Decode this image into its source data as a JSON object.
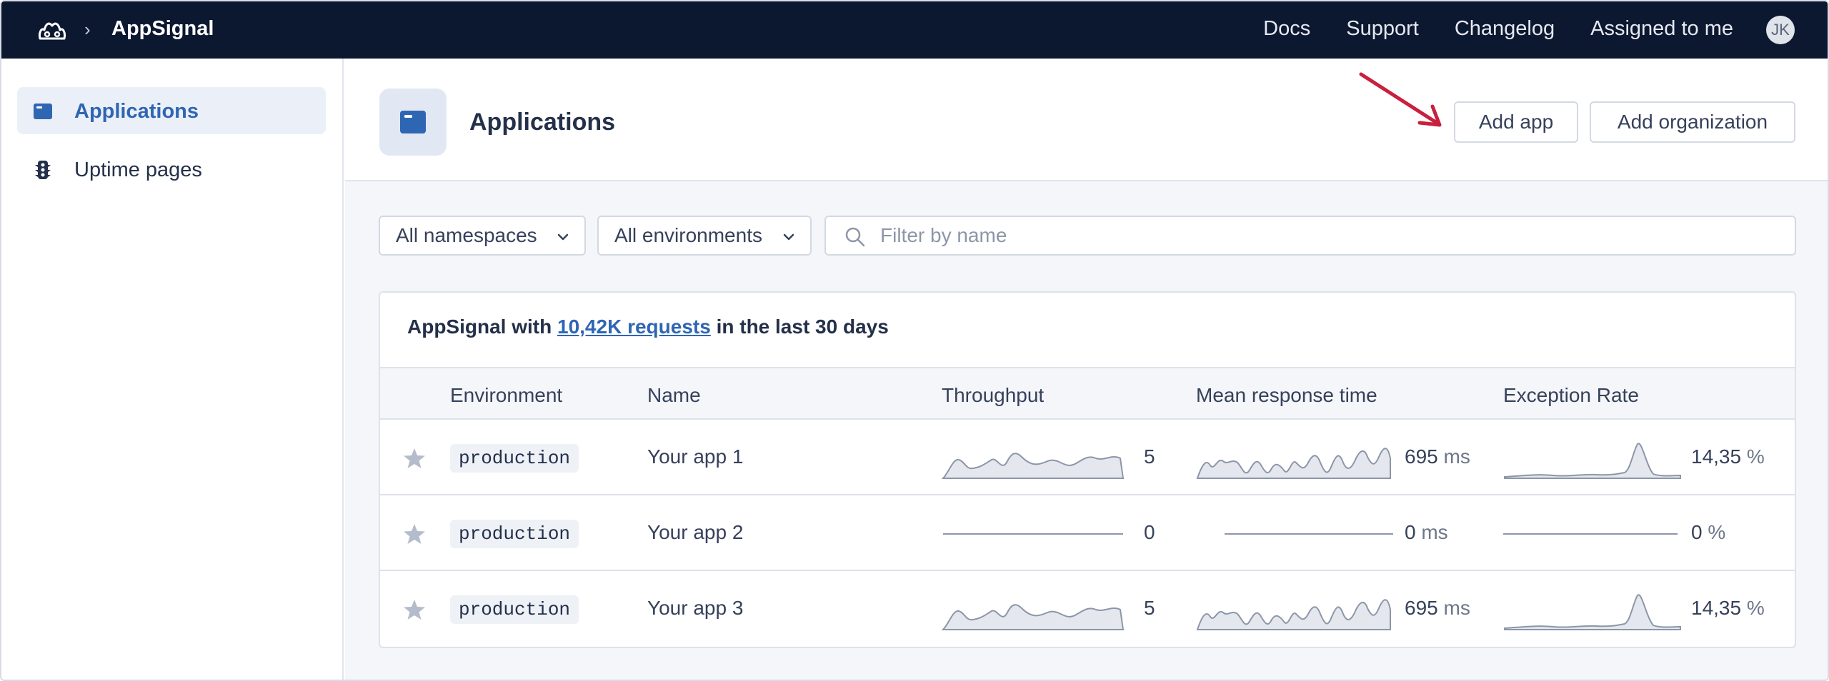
{
  "topbar": {
    "brand": "AppSignal",
    "separator": "›",
    "nav": [
      "Docs",
      "Support",
      "Changelog",
      "Assigned to me"
    ],
    "avatar_initials": "JK"
  },
  "sidebar": {
    "items": [
      {
        "label": "Applications",
        "icon": "app-window-icon",
        "active": true
      },
      {
        "label": "Uptime pages",
        "icon": "traffic-light-icon",
        "active": false
      }
    ]
  },
  "header": {
    "title": "Applications",
    "add_app_label": "Add app",
    "add_org_label": "Add organization"
  },
  "filters": {
    "namespaces": "All namespaces",
    "environments": "All environments",
    "search_placeholder": "Filter by name"
  },
  "card": {
    "title_prefix": "AppSignal with ",
    "title_link": "10,42K requests",
    "title_suffix": " in the last 30 days"
  },
  "table": {
    "columns": [
      "Environment",
      "Name",
      "Throughput",
      "Mean response time",
      "Exception Rate"
    ],
    "rows": [
      {
        "env": "production",
        "name": "Your app 1",
        "throughput": "5",
        "response": "695",
        "response_unit": "ms",
        "exceptions": "14,35",
        "exceptions_unit": "%",
        "flat": false
      },
      {
        "env": "production",
        "name": "Your app 2",
        "throughput": "0",
        "response": "0",
        "response_unit": "ms",
        "exceptions": "0",
        "exceptions_unit": "%",
        "flat": true
      },
      {
        "env": "production",
        "name": "Your app 3",
        "throughput": "5",
        "response": "695",
        "response_unit": "ms",
        "exceptions": "14,35",
        "exceptions_unit": "%",
        "flat": false
      }
    ]
  },
  "colors": {
    "topbar_bg": "#0c1730",
    "accent": "#2f66b3",
    "arrow": "#c8203f"
  }
}
